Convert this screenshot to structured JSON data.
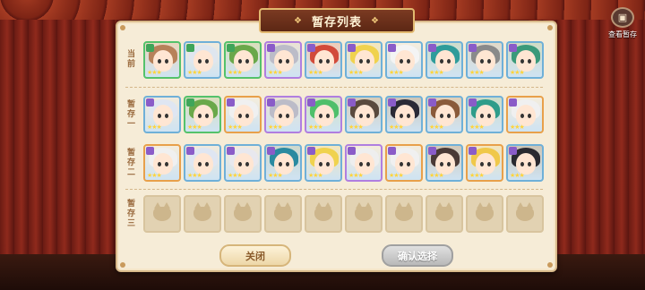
{
  "title": "暂存列表",
  "view_button_label": "查看暂存",
  "rows": [
    {
      "label_chars": [
        "当",
        "前"
      ],
      "slots": [
        {
          "hair": "#b7815a",
          "border": "#54c26b",
          "rank": "#3fa55a"
        },
        {
          "hair": "#dfe6ef",
          "border": "#6fb0d8",
          "rank": "#3fa55a"
        },
        {
          "hair": "#6aa84a",
          "border": "#54c26b",
          "rank": "#3fa55a"
        },
        {
          "hair": "#bcbcc8",
          "border": "#b07ee0",
          "rank": "#8a5cc8"
        },
        {
          "hair": "#d24a3a",
          "border": "#6fb0d8",
          "rank": "#8a5cc8"
        },
        {
          "hair": "#f0d24e",
          "border": "#6fb0d8",
          "rank": "#8a5cc8"
        },
        {
          "hair": "#f4f4f4",
          "border": "#6fb0d8",
          "rank": "#8a5cc8"
        },
        {
          "hair": "#2f9c9a",
          "border": "#6fb0d8",
          "rank": "#8a5cc8"
        },
        {
          "hair": "#8a8a8a",
          "border": "#6fb0d8",
          "rank": "#8a5cc8"
        },
        {
          "hair": "#3a9a7a",
          "border": "#6fb0d8",
          "rank": "#8a5cc8"
        }
      ]
    },
    {
      "label_chars": [
        "暂",
        "存",
        "一"
      ],
      "slots": [
        {
          "hair": "#dfe6f2",
          "border": "#6fb0d8",
          "rank": "#8a5cc8"
        },
        {
          "hair": "#6aa84a",
          "border": "#54c26b",
          "rank": "#3fa55a"
        },
        {
          "hair": "#f0f0f0",
          "border": "#e8a04a",
          "rank": "#8a5cc8"
        },
        {
          "hair": "#bcbcc8",
          "border": "#b07ee0",
          "rank": "#8a5cc8"
        },
        {
          "hair": "#4fbf6a",
          "border": "#b07ee0",
          "rank": "#8a5cc8"
        },
        {
          "hair": "#5a4a3e",
          "border": "#6fb0d8",
          "rank": "#8a5cc8"
        },
        {
          "hair": "#2a2a36",
          "border": "#6fb0d8",
          "rank": "#8a5cc8"
        },
        {
          "hair": "#8a5a3a",
          "border": "#6fb0d8",
          "rank": "#8a5cc8"
        },
        {
          "hair": "#2f9c8a",
          "border": "#6fb0d8",
          "rank": "#8a5cc8"
        },
        {
          "hair": "#f0f0f0",
          "border": "#e8a04a",
          "rank": "#8a5cc8"
        }
      ]
    },
    {
      "label_chars": [
        "暂",
        "存",
        "二"
      ],
      "slots": [
        {
          "hair": "#f0f0f0",
          "border": "#e8a04a",
          "rank": "#8a5cc8"
        },
        {
          "hair": "#dfe6f2",
          "border": "#6fb0d8",
          "rank": "#8a5cc8"
        },
        {
          "hair": "#e8e8ee",
          "border": "#6fb0d8",
          "rank": "#8a5cc8"
        },
        {
          "hair": "#2a8aa0",
          "border": "#6fb0d8",
          "rank": "#8a5cc8"
        },
        {
          "hair": "#f0d24e",
          "border": "#6fb0d8",
          "rank": "#8a5cc8"
        },
        {
          "hair": "#eeeeee",
          "border": "#b07ee0",
          "rank": "#8a5cc8"
        },
        {
          "hair": "#f0f0f0",
          "border": "#e8a04a",
          "rank": "#8a5cc8"
        },
        {
          "hair": "#4a3a36",
          "border": "#6fb0d8",
          "rank": "#8a5cc8"
        },
        {
          "hair": "#f0c84a",
          "border": "#e8a04a",
          "rank": "#8a5cc8"
        },
        {
          "hair": "#2a2a30",
          "border": "#6fb0d8",
          "rank": "#8a5cc8"
        }
      ]
    },
    {
      "label_chars": [
        "暂",
        "存",
        "三"
      ],
      "empty_count": 10
    }
  ],
  "buttons": {
    "close": "关闭",
    "confirm": "确认选择"
  }
}
